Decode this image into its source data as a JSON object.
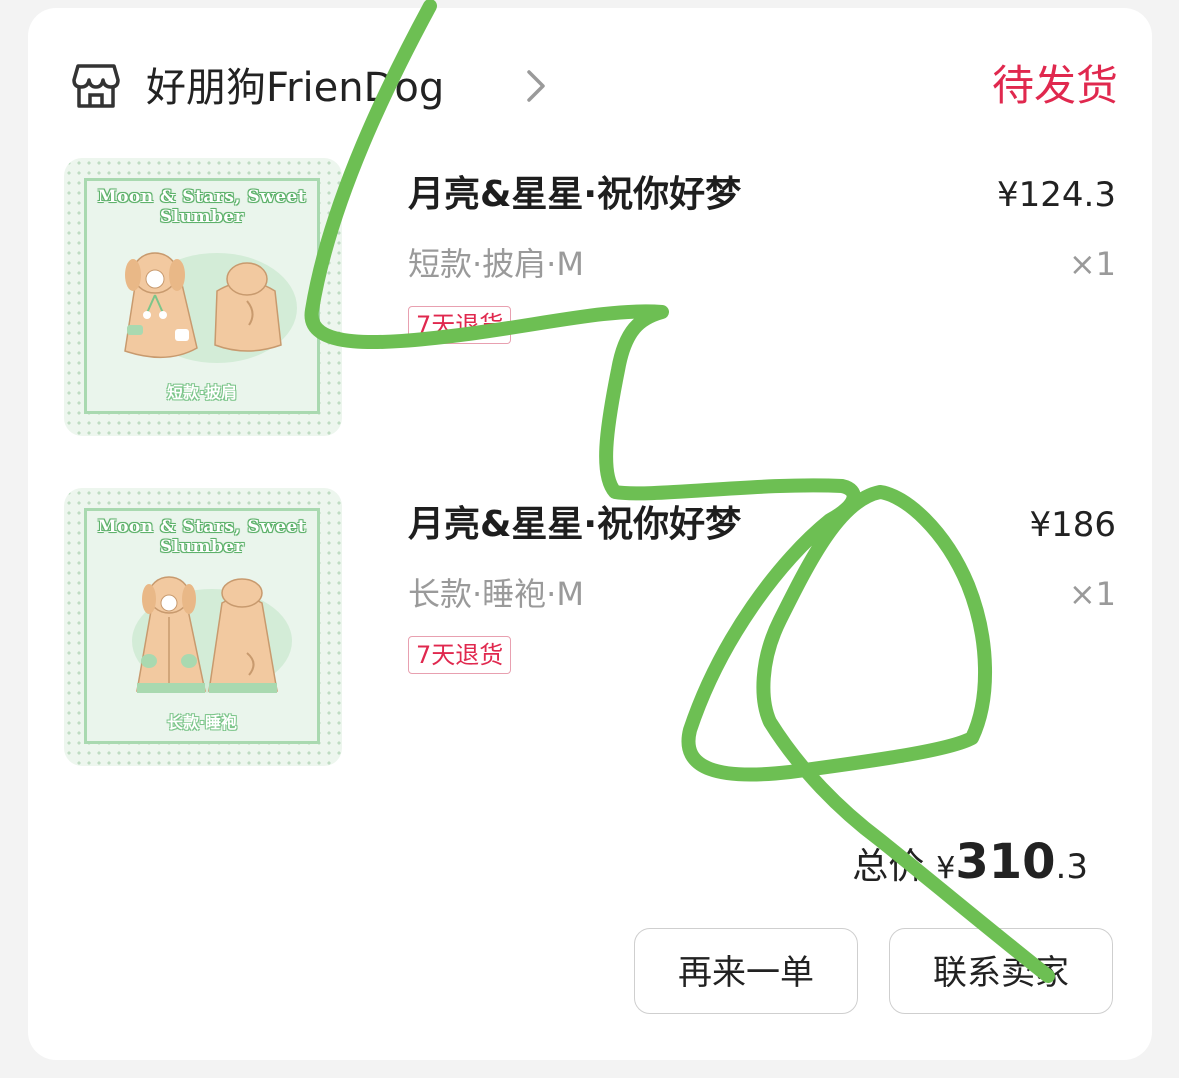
{
  "store": {
    "name": "好朋狗FrienDog",
    "status": "待发货",
    "icon": "store-icon"
  },
  "items": [
    {
      "title": "月亮&星星·祝你好梦",
      "spec": "短款·披肩·M",
      "badge": "7天退货",
      "price": "¥124.3",
      "qty": "×1",
      "thumb_title": "Moon & Stars, Sweet Slumber",
      "thumb_caption": "短款·披肩"
    },
    {
      "title": "月亮&星星·祝你好梦",
      "spec": "长款·睡袍·M",
      "badge": "7天退货",
      "price": "¥186",
      "qty": "×1",
      "thumb_title": "Moon & Stars, Sweet Slumber",
      "thumb_caption": "长款·睡袍"
    }
  ],
  "total": {
    "label": "总价",
    "currency": "¥",
    "integer": "310",
    "decimal": ".3"
  },
  "actions": {
    "reorder": "再来一单",
    "contact": "联系卖家"
  },
  "colors": {
    "status": "#e0284e",
    "scribble": "#6dbf53",
    "thumb_green": "#a9d9b0",
    "costume_peach": "#f2c9a0"
  }
}
